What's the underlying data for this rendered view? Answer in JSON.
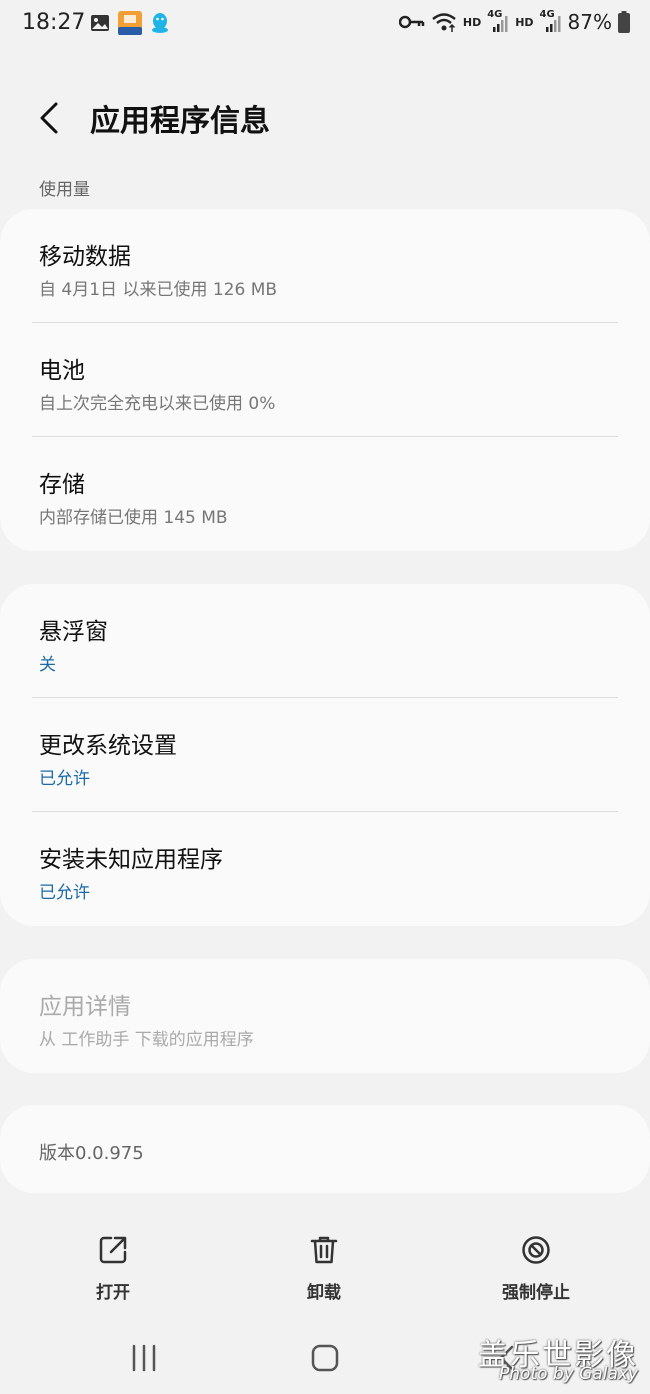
{
  "status_bar": {
    "time": "18:27",
    "network_4g_1": "4G",
    "network_hd_1": "HD",
    "network_4g_2": "4G",
    "network_hd_2": "HD",
    "battery": "87%",
    "app_icon_text": "工作助手"
  },
  "header": {
    "title": "应用程序信息"
  },
  "usage": {
    "section_label": "使用量",
    "items": [
      {
        "title": "移动数据",
        "subtitle": "自 4月1日 以来已使用 126 MB"
      },
      {
        "title": "电池",
        "subtitle": "自上次完全充电以来已使用 0%"
      },
      {
        "title": "存储",
        "subtitle": "内部存储已使用 145 MB"
      }
    ]
  },
  "permissions": {
    "items": [
      {
        "title": "悬浮窗",
        "subtitle": "关"
      },
      {
        "title": "更改系统设置",
        "subtitle": "已允许"
      },
      {
        "title": "安装未知应用程序",
        "subtitle": "已允许"
      }
    ]
  },
  "details": {
    "title": "应用详情",
    "subtitle": "从 工作助手 下载的应用程序"
  },
  "version": {
    "text": "版本0.0.975"
  },
  "actions": {
    "open_label": "打开",
    "uninstall_label": "卸载",
    "force_stop_label": "强制停止"
  },
  "watermark": {
    "line1": "盖乐世影像",
    "line2": "Photo by Galaxy"
  },
  "colors": {
    "background": "#f2f2f2",
    "card": "#fafafa",
    "link_blue": "#1a6aa8"
  }
}
